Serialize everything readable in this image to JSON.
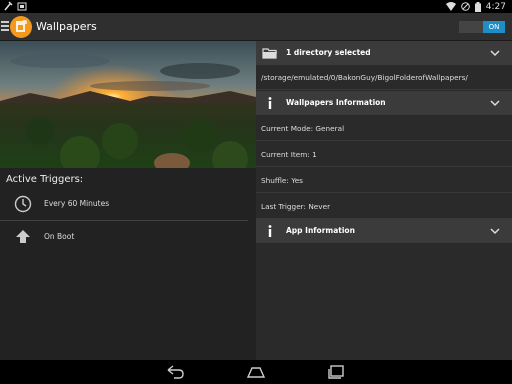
{
  "status_bar": {
    "time": "4:27",
    "icons": [
      "tool-icon",
      "image-notification-icon",
      "wifi-icon",
      "no-signal-icon",
      "battery-icon"
    ]
  },
  "action_bar": {
    "title": "Wallpapers",
    "toggle_label": "ON",
    "accent": "#1e8ec9",
    "logo_color": "#f39a1e"
  },
  "hero_image": {
    "icon": "sunset-landscape-image"
  },
  "triggers": {
    "title": "Active Triggers:",
    "items": [
      {
        "label": "Every 60 Minutes",
        "icon": "clock-icon"
      },
      {
        "label": "On Boot",
        "icon": "boot-arrow-icon"
      }
    ]
  },
  "directory": {
    "header": "1 directory selected",
    "path": "/storage/emulated/0/BakonGuy/BigolFolderofWallpapers/"
  },
  "info": {
    "header": "Wallpapers Information",
    "rows": [
      "Current Mode: General",
      "Current Item: 1",
      "Shuffle: Yes",
      "Last Trigger: Never"
    ]
  },
  "app_info": {
    "header": "App Information"
  },
  "colors": {
    "background": "#222222",
    "panel": "#2a2a2a",
    "header": "#3b3b3b"
  }
}
